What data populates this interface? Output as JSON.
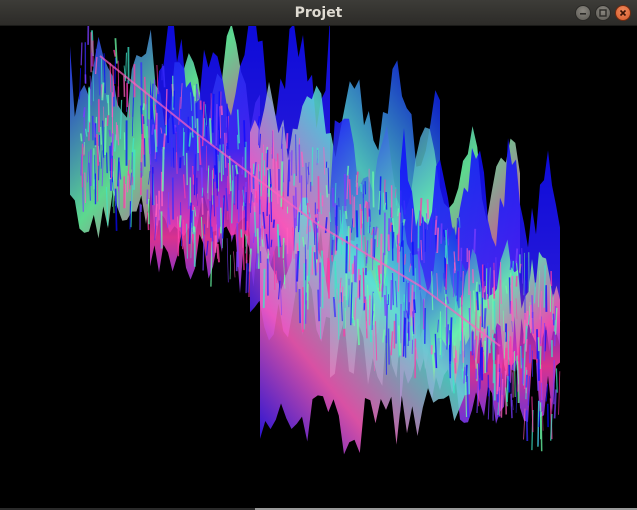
{
  "window": {
    "title": "Projet"
  },
  "controls": {
    "minimize_icon": "minimize-icon",
    "maximize_icon": "maximize-icon",
    "close_icon": "close-icon"
  },
  "render": {
    "background": "#000000",
    "palette": [
      "#0a0aff",
      "#3a2cff",
      "#ff3aa8",
      "#ff5fc0",
      "#6dffa8",
      "#3fe6c8",
      "#7a3cff"
    ]
  }
}
